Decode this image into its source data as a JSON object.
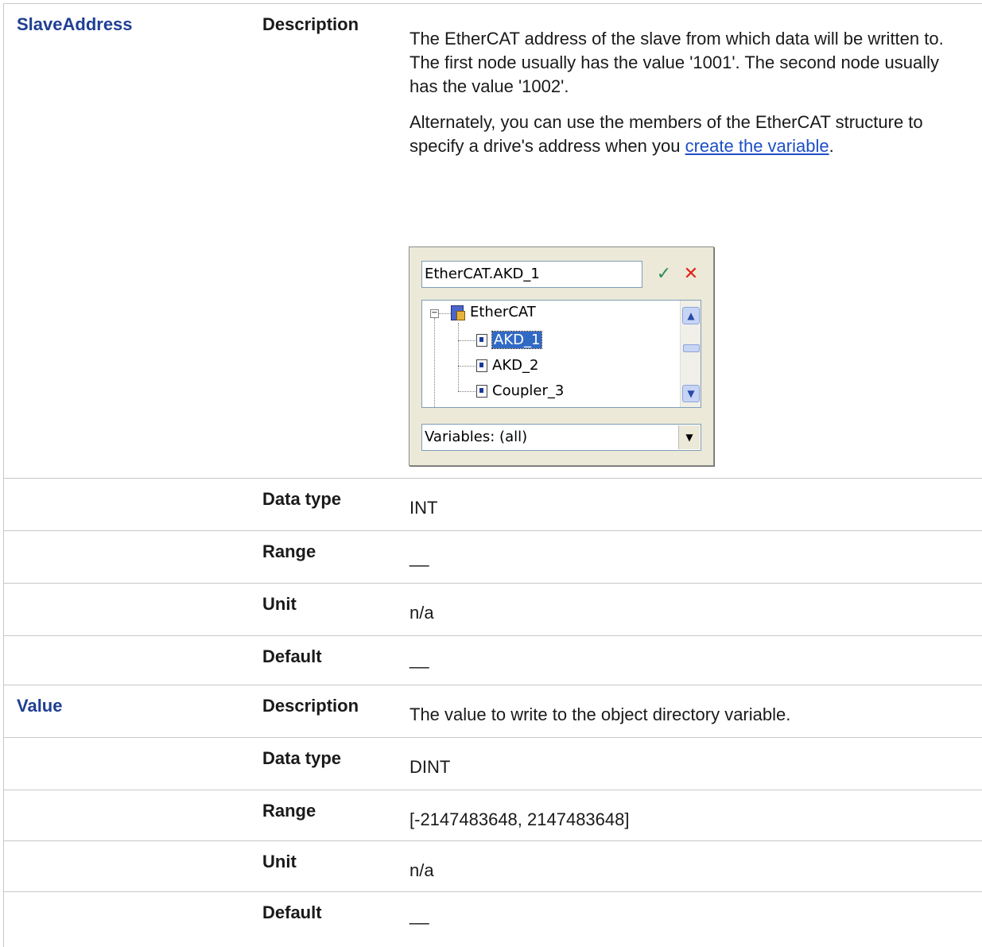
{
  "rows": [
    {
      "param": "SlaveAddress",
      "field": "Description",
      "desc_p1": "The EtherCAT address of the slave from which data will be written to.",
      "desc_p2": "The first node usually has the value '1001'. The second node usually has the value '1002'.",
      "desc_p3_prefix": "Alternately, you can use the members of the EtherCAT structure to specify a drive's address when you ",
      "desc_p3_link": "create the variable",
      "desc_p3_suffix": "."
    },
    {
      "field": "Data type",
      "value": "INT"
    },
    {
      "field": "Range",
      "value": "__"
    },
    {
      "field": "Unit",
      "value": "n/a"
    },
    {
      "field": "Default",
      "value": "__"
    },
    {
      "param": "Value",
      "field": "Description",
      "value": "The value to write to the object directory variable."
    },
    {
      "field": "Data type",
      "value": "DINT"
    },
    {
      "field": "Range",
      "value": "[-2147483648, 2147483648]"
    },
    {
      "field": "Unit",
      "value": "n/a"
    },
    {
      "field": "Default",
      "value": "__"
    }
  ],
  "dialog": {
    "input_value": "EtherCAT.AKD_1",
    "ok_icon": "checkmark-icon",
    "cancel_icon": "red-x-icon",
    "tree": {
      "root": "EtherCAT",
      "items": [
        "AKD_1",
        "AKD_2",
        "Coupler_3"
      ],
      "selected": "AKD_1"
    },
    "filter_value": "Variables: (all)"
  },
  "colors": {
    "param_text": "#1f3f93",
    "link": "#1d4fc4",
    "selection": "#316ac5"
  }
}
